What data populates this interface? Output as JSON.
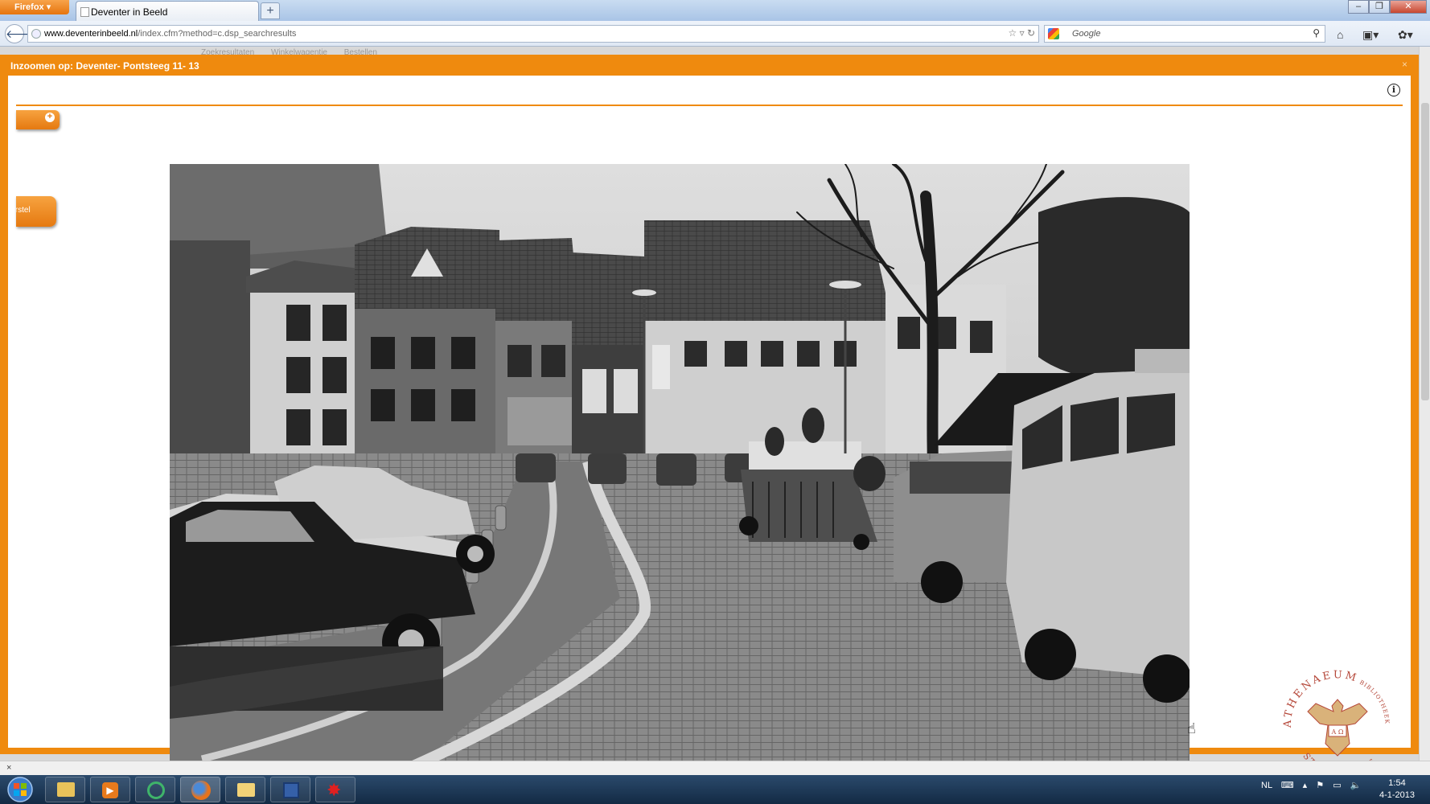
{
  "browser": {
    "menu_button": "Firefox",
    "tab_title": "Deventer in Beeld",
    "new_tab": "+",
    "url_domain": "www.deventerinbeeld.nl",
    "url_path": "/index.cfm?method=c.dsp_searchresults",
    "search_placeholder": "Google",
    "status_close": "×"
  },
  "page": {
    "background_tabs": [
      "Zoekresultaten",
      "Winkelwagentje",
      "Bestellen"
    ]
  },
  "modal": {
    "title": "Inzoomen op: Deventer- Pontsteeg 11- 13",
    "close": "×",
    "info_symbol": "i",
    "zoom_symbol": "+",
    "reset_label": "Herstel",
    "accent_color": "#ef8a0e"
  },
  "seal": {
    "text_top": "ATHENAEUM",
    "text_right": "BIBLIOTHEEK",
    "text_bottom": "STADSARCHIEF",
    "letters": "A Ω",
    "color": "#b5483a"
  },
  "taskbar": {
    "language": "NL",
    "time": "1:54",
    "date": "4-1-2013"
  }
}
